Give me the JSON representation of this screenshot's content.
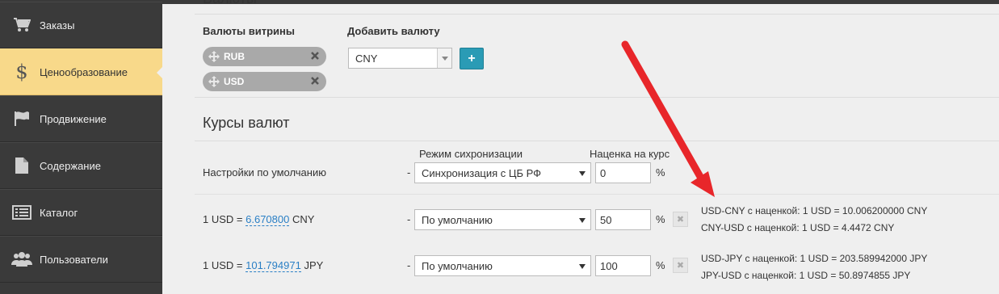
{
  "sidebar": {
    "items": [
      {
        "label": "Заказы",
        "icon": "cart-icon",
        "active": false
      },
      {
        "label": "Ценообразование",
        "icon": "dollar-icon",
        "active": true
      },
      {
        "label": "Продвижение",
        "icon": "flag-icon",
        "active": false
      },
      {
        "label": "Содержание",
        "icon": "document-icon",
        "active": false
      },
      {
        "label": "Каталог",
        "icon": "list-icon",
        "active": false
      },
      {
        "label": "Пользователи",
        "icon": "users-icon",
        "active": false
      }
    ]
  },
  "currencies": {
    "section_title": "Валюты",
    "storefront_label": "Валюты витрины",
    "add_label": "Добавить валюту",
    "tags": [
      "RUB",
      "USD"
    ],
    "add_select_value": "CNY",
    "add_button": "+"
  },
  "rates": {
    "title": "Курсы валют",
    "col_sync": "Режим сихронизации",
    "col_markup": "Наценка на курс",
    "default_row": {
      "label": "Настройки по умолчанию",
      "dash": "-",
      "sync": "Синхронизация с ЦБ РФ",
      "markup": "0",
      "pct": "%"
    },
    "rows": [
      {
        "prefix": "1 USD =",
        "rate": "6.670800",
        "currency": "CNY",
        "dash": "-",
        "sync": "По умолчанию",
        "markup": "50",
        "pct": "%",
        "remove": "✖",
        "info1": "USD-CNY с наценкой: 1 USD = 10.006200000 CNY",
        "info2": "CNY-USD с наценкой: 1 USD = 4.4472 CNY"
      },
      {
        "prefix": "1 USD =",
        "rate": "101.794971",
        "currency": "JPY",
        "dash": "-",
        "sync": "По умолчанию",
        "markup": "100",
        "pct": "%",
        "remove": "✖",
        "info1": "USD-JPY с наценкой: 1 USD = 203.589942000 JPY",
        "info2": "JPY-USD с наценкой: 1 USD = 50.8974855 JPY"
      }
    ]
  },
  "annotation_color": "#e8262a"
}
